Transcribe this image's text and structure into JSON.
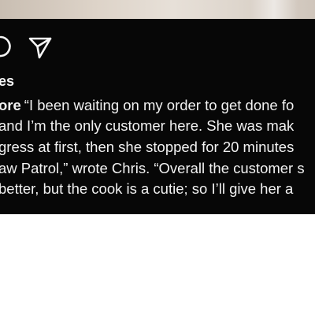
{
  "post": {
    "likes_fragment": "es",
    "username_fragment": "ore",
    "caption_lines": [
      "“I been waiting on my order to get done fo",
      " and I’m the only customer here. She was mak",
      "gress at first, then she stopped for 20 minutes",
      "aw Patrol,” wrote Chris. “Overall the customer s",
      " better, but the cook is a cutie; so I’ll give her a"
    ]
  },
  "icons": {
    "comment": "comment-icon",
    "share": "share-icon"
  },
  "colors": {
    "panel_background": "#070707",
    "text": "#f2f2f2",
    "page_background": "#ffffff"
  }
}
